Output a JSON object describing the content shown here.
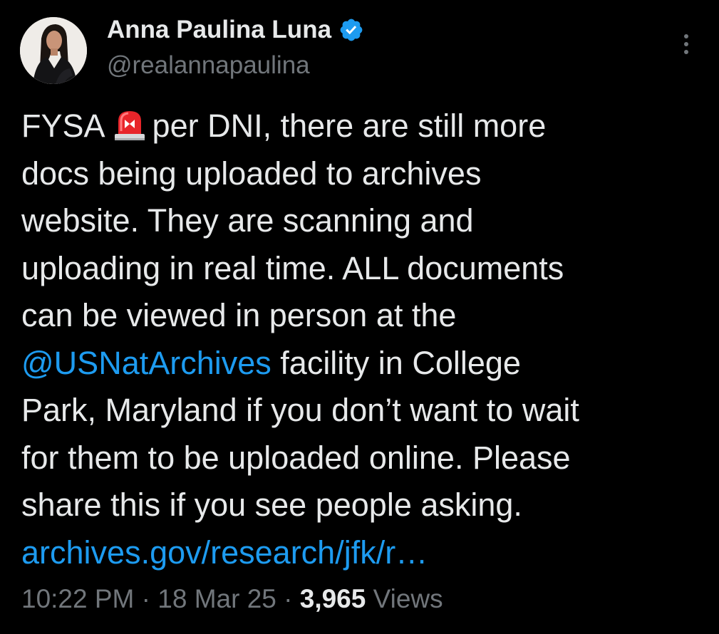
{
  "author": {
    "display_name": "Anna Paulina Luna",
    "handle": "@realannapaulina",
    "verified": true,
    "verified_color": "#1d9bf0"
  },
  "tweet": {
    "line1_a": "FYSA",
    "siren_icon": "police-siren-icon",
    "line1_b": "per DNI, there are still more",
    "line2": "docs being uploaded to archives",
    "line3": "website. They are scanning and",
    "line4": "uploading in real time. ALL documents",
    "line5": "can be viewed in person at the",
    "mention": "@USNatArchives",
    "line6_rest": " facility in College",
    "line7": "Park, Maryland if you don’t want to wait",
    "line8": "for them to be uploaded online. Please",
    "line9": "share this if you see people asking.",
    "link": "archives.gov/research/jfk/r…"
  },
  "meta": {
    "time": "10:22 PM",
    "separator": " · ",
    "date": "18 Mar 25",
    "views_count": "3,965",
    "views_label": " Views"
  },
  "colors": {
    "background": "#000000",
    "text": "#e7e9ea",
    "secondary": "#71767b",
    "link": "#1d9bf0"
  }
}
